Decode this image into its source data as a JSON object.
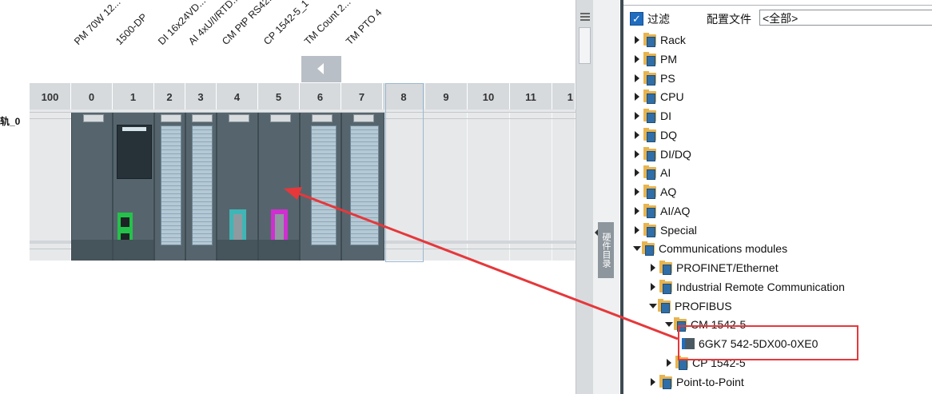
{
  "device_view": {
    "module_labels": [
      "PM 70W 12...",
      "1500-DP",
      "DI 16x24VD...",
      "AI 4xU/I/RTD...",
      "CM PtP RS42...",
      "CP 1542-5_1",
      "TM Count 2...",
      "TM PTO 4"
    ],
    "slot_numbers": [
      "100",
      "0",
      "1",
      "2",
      "3",
      "4",
      "5",
      "6",
      "7",
      "8",
      "9",
      "10",
      "11",
      "1"
    ],
    "rail_label": "轨_0"
  },
  "catalog": {
    "filter_label": "过滤",
    "filter_checked": true,
    "profile_label": "配置文件",
    "profile_value": "<全部>",
    "tree": [
      {
        "label": "Rack",
        "expanded": false
      },
      {
        "label": "PM",
        "expanded": false
      },
      {
        "label": "PS",
        "expanded": false
      },
      {
        "label": "CPU",
        "expanded": false
      },
      {
        "label": "DI",
        "expanded": false
      },
      {
        "label": "DQ",
        "expanded": false
      },
      {
        "label": "DI/DQ",
        "expanded": false
      },
      {
        "label": "AI",
        "expanded": false
      },
      {
        "label": "AQ",
        "expanded": false
      },
      {
        "label": "AI/AQ",
        "expanded": false
      },
      {
        "label": "Special",
        "expanded": false
      },
      {
        "label": "Communications modules",
        "expanded": true
      },
      {
        "label": "PROFINET/Ethernet",
        "expanded": false
      },
      {
        "label": "Industrial Remote Communication",
        "expanded": false
      },
      {
        "label": "PROFIBUS",
        "expanded": true
      },
      {
        "label": "CM 1542-5",
        "expanded": true
      },
      {
        "label": "6GK7 542-5DX00-0XE0",
        "expanded": false
      },
      {
        "label": "CP 1542-5",
        "expanded": false
      },
      {
        "label": "Point-to-Point",
        "expanded": false
      }
    ]
  },
  "task_tab_label": "硬件目录",
  "colors": {
    "highlight": "#e5383b",
    "accent": "#1f6dc1"
  }
}
